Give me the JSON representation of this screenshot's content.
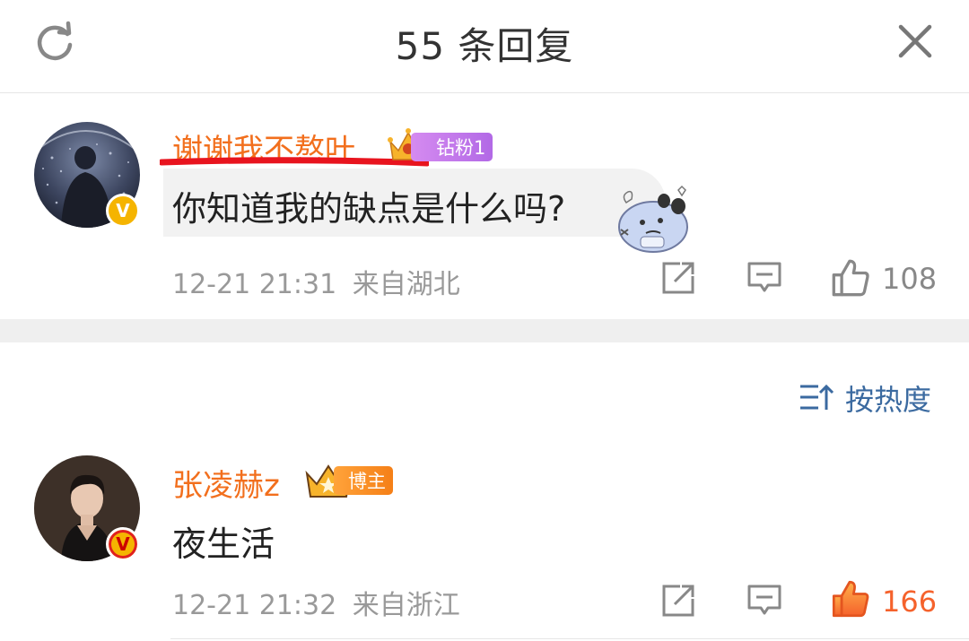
{
  "header": {
    "title": "55 条回复",
    "refresh_icon": "refresh-icon",
    "close_icon": "close-icon"
  },
  "main_comment": {
    "username": "谢谢我不熬叶",
    "badge_label": "钻粉1",
    "text": "你知道我的缺点是什么吗?",
    "timestamp": "12-21 21:31",
    "location": "来自湖北",
    "likes": "108",
    "name_color": "#f26f1d",
    "underline_color": "#e8141e"
  },
  "sort": {
    "label": "按热度",
    "icon": "sort-icon"
  },
  "reply": {
    "username": "张凌赫z",
    "badge_label": "博主",
    "text": "夜生活",
    "timestamp": "12-21 21:32",
    "location": "来自浙江",
    "likes": "166",
    "liked": true,
    "like_color": "#f5622c"
  },
  "colors": {
    "accent_orange": "#f26f1d",
    "link_blue": "#3b6aa0",
    "meta_gray": "#999999",
    "divider": "#efefef"
  }
}
